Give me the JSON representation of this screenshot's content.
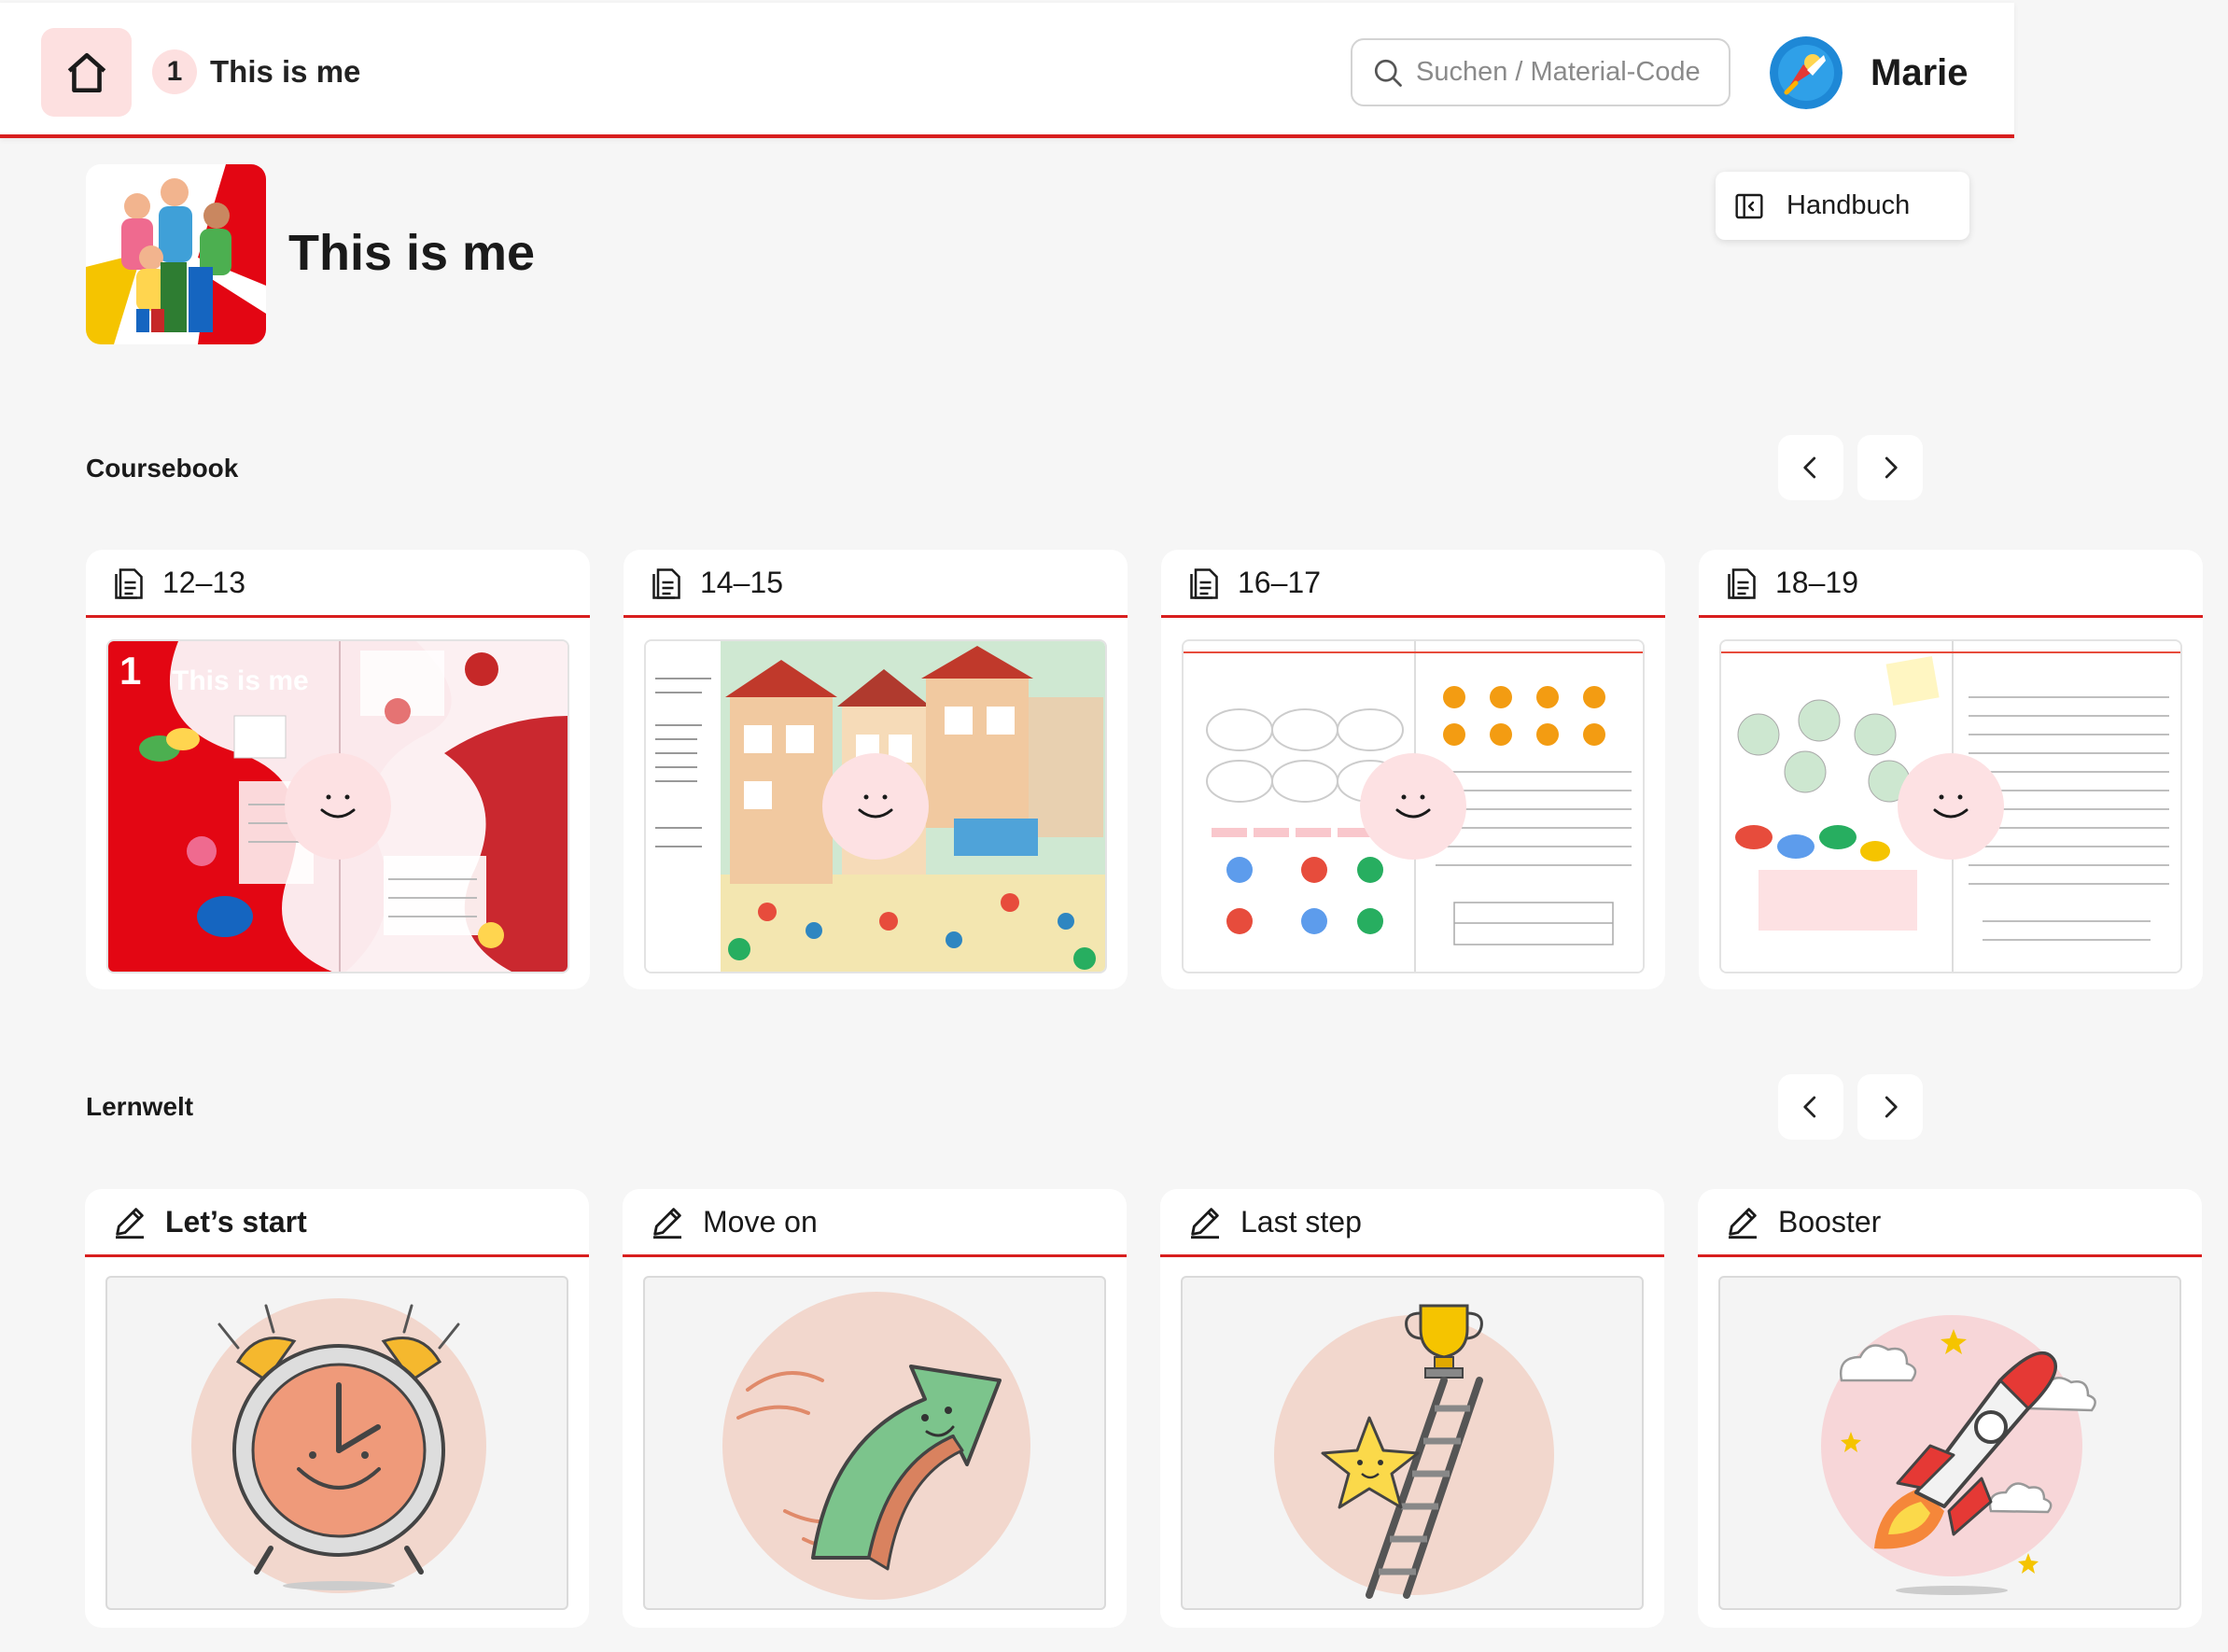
{
  "header": {
    "unit_number": "1",
    "unit_title": "This is me",
    "search_placeholder": "Suchen / Material-Code",
    "user_name": "Marie"
  },
  "page": {
    "title": "This is me",
    "handbuch_label": "Handbuch"
  },
  "coursebook": {
    "title": "Coursebook",
    "cards": [
      {
        "pages": "12–13",
        "cover_title_num": "1",
        "cover_title": "This is me"
      },
      {
        "pages": "14–15"
      },
      {
        "pages": "16–17"
      },
      {
        "pages": "18–19"
      }
    ]
  },
  "lernwelt": {
    "title": "Lernwelt",
    "cards": [
      {
        "label": "Let’s start",
        "illustration": "alarm-clock"
      },
      {
        "label": "Move on",
        "illustration": "arrow"
      },
      {
        "label": "Last step",
        "illustration": "star-ladder-trophy"
      },
      {
        "label": "Booster",
        "illustration": "rocket"
      }
    ]
  },
  "colors": {
    "accent": "#d81e1e",
    "accent_soft": "#fde0e0",
    "background": "#f6f6f6"
  }
}
